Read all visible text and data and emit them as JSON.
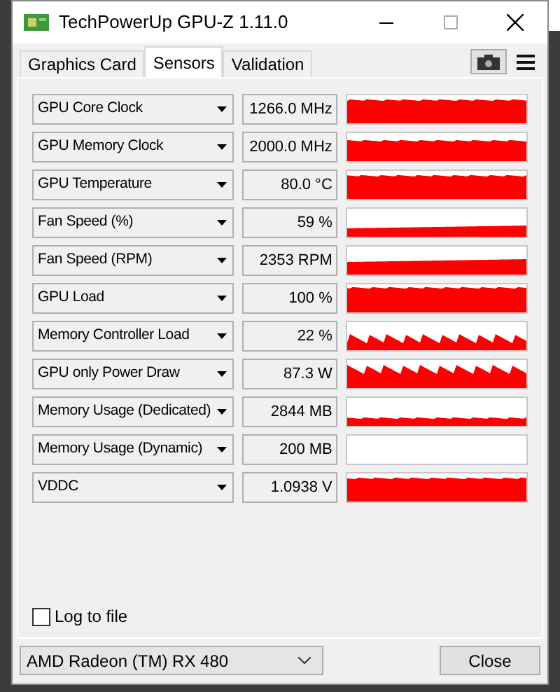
{
  "window": {
    "title": "TechPowerUp GPU-Z 1.11.0"
  },
  "tabs": [
    {
      "label": "Graphics Card",
      "selected": false
    },
    {
      "label": "Sensors",
      "selected": true
    },
    {
      "label": "Validation",
      "selected": false
    }
  ],
  "sensors": [
    {
      "name": "GPU Core Clock",
      "value": "1266.0 MHz"
    },
    {
      "name": "GPU Memory Clock",
      "value": "2000.0 MHz"
    },
    {
      "name": "GPU Temperature",
      "value": "80.0 °C"
    },
    {
      "name": "Fan Speed (%)",
      "value": "59 %"
    },
    {
      "name": "Fan Speed (RPM)",
      "value": "2353 RPM"
    },
    {
      "name": "GPU Load",
      "value": "100 %"
    },
    {
      "name": "Memory Controller Load",
      "value": "22 %"
    },
    {
      "name": "GPU only Power Draw",
      "value": "87.3 W"
    },
    {
      "name": "Memory Usage (Dedicated)",
      "value": "2844 MB"
    },
    {
      "name": "Memory Usage (Dynamic)",
      "value": "200 MB"
    },
    {
      "name": "VDDC",
      "value": "1.0938 V"
    }
  ],
  "log_to_file": {
    "label": "Log to file",
    "checked": false
  },
  "device_select": {
    "value": "AMD Radeon (TM) RX 480"
  },
  "buttons": [
    "Close"
  ]
}
